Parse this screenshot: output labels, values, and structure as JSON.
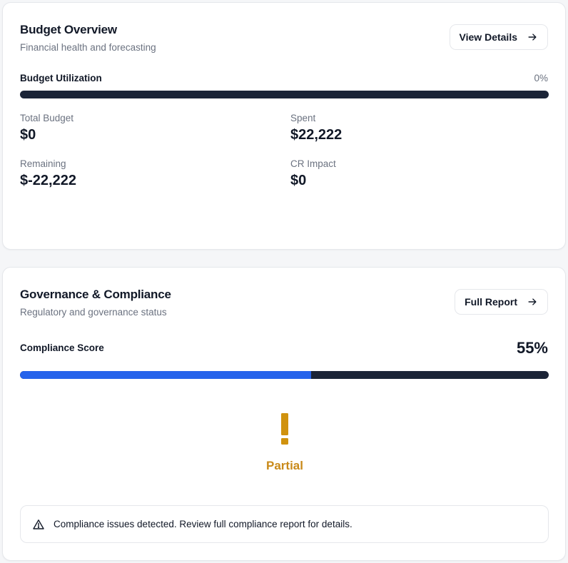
{
  "budget": {
    "title": "Budget Overview",
    "subtitle": "Financial health and forecasting",
    "button_label": "View Details",
    "utilization_label": "Budget Utilization",
    "utilization_pct_text": "0%",
    "utilization_fraction": 0,
    "stats": {
      "total_budget": {
        "label": "Total Budget",
        "value": "$0"
      },
      "spent": {
        "label": "Spent",
        "value": "$22,222"
      },
      "remaining": {
        "label": "Remaining",
        "value": "$-22,222"
      },
      "cr_impact": {
        "label": "CR Impact",
        "value": "$0"
      }
    }
  },
  "governance": {
    "title": "Governance & Compliance",
    "subtitle": "Regulatory and governance status",
    "button_label": "Full Report",
    "score_label": "Compliance Score",
    "score_pct_text": "55%",
    "score_fraction": 0.55,
    "status_label": "Partial",
    "alert_text": "Compliance issues detected. Review full compliance report for details."
  },
  "colors": {
    "bar_track": "#1b2437",
    "bar_fill": "#2563eb",
    "status_warning": "#c98a1a",
    "text_primary": "#111827",
    "text_muted": "#6b7280"
  },
  "icons": {
    "button_arrow": "arrow-right-icon",
    "status": "exclamation-icon",
    "alert": "warning-triangle-icon"
  }
}
